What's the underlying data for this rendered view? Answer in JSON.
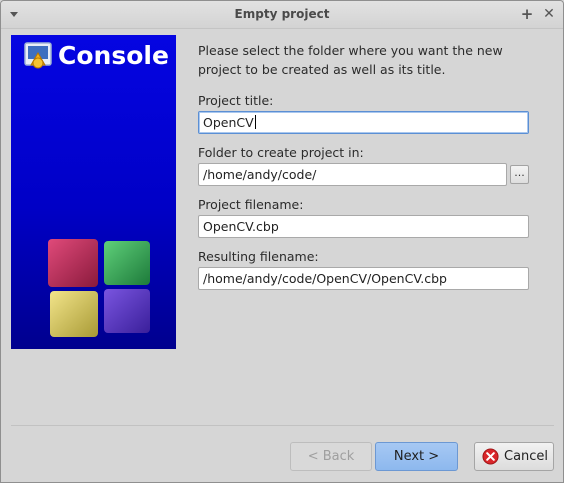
{
  "window": {
    "title": "Empty project"
  },
  "banner": {
    "title": "Console"
  },
  "intro": "Please select the folder where you want the new project to be created as well as its title.",
  "fields": {
    "project_title": {
      "label": "Project title:",
      "value": "OpenCV"
    },
    "folder": {
      "label": "Folder to create project in:",
      "value": "/home/andy/code/",
      "browse_label": "..."
    },
    "filename": {
      "label": "Project filename:",
      "value": "OpenCV.cbp"
    },
    "resulting": {
      "label": "Resulting filename:",
      "value": "/home/andy/code/OpenCV/OpenCV.cbp"
    }
  },
  "buttons": {
    "back": "< Back",
    "next": "Next >",
    "cancel": "Cancel"
  },
  "titlebar_icons": {
    "menu": "menu-arrow-icon",
    "maximize": "plus-icon",
    "close": "close-icon"
  }
}
